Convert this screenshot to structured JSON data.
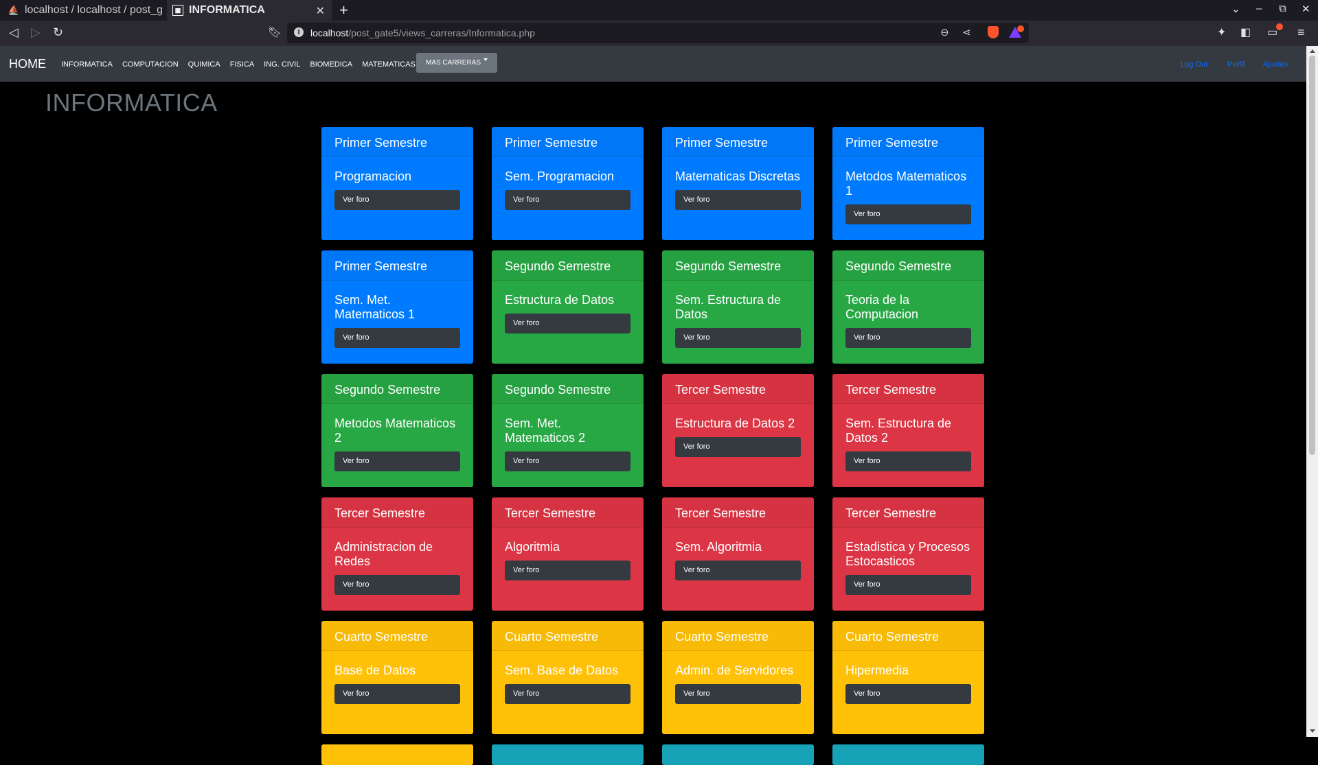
{
  "browser": {
    "tabs": [
      {
        "title": "localhost / localhost / post_g",
        "active": false
      },
      {
        "title": "INFORMATICA",
        "active": true
      }
    ],
    "url_host": "localhost",
    "url_path": "/post_gate5/views_carreras/Informatica.php"
  },
  "nav": {
    "brand": "HOME",
    "links": [
      "INFORMATICA",
      "COMPUTACION",
      "QUIMICA",
      "FISICA",
      "ING. CIVIL",
      "BIOMEDICA",
      "MATEMATICAS"
    ],
    "dropdown": "MAS CARRERAS",
    "logout": "Log Out",
    "perfil": "Perfil",
    "ajustes": "Ajustes"
  },
  "page": {
    "title": "INFORMATICA",
    "button_label": "Ver foro",
    "courses": [
      {
        "semester": "Primer Semestre",
        "name": "Programacion",
        "color": "blue"
      },
      {
        "semester": "Primer Semestre",
        "name": "Sem. Programacion",
        "color": "blue"
      },
      {
        "semester": "Primer Semestre",
        "name": "Matematicas Discretas",
        "color": "blue"
      },
      {
        "semester": "Primer Semestre",
        "name": "Metodos Matematicos 1",
        "color": "blue"
      },
      {
        "semester": "Primer Semestre",
        "name": "Sem. Met. Matematicos 1",
        "color": "blue"
      },
      {
        "semester": "Segundo Semestre",
        "name": "Estructura de Datos",
        "color": "green"
      },
      {
        "semester": "Segundo Semestre",
        "name": "Sem. Estructura de Datos",
        "color": "green"
      },
      {
        "semester": "Segundo Semestre",
        "name": "Teoria de la Computacion",
        "color": "green"
      },
      {
        "semester": "Segundo Semestre",
        "name": "Metodos Matematicos 2",
        "color": "green"
      },
      {
        "semester": "Segundo Semestre",
        "name": "Sem. Met. Matematicos 2",
        "color": "green"
      },
      {
        "semester": "Tercer Semestre",
        "name": "Estructura de Datos 2",
        "color": "red"
      },
      {
        "semester": "Tercer Semestre",
        "name": "Sem. Estructura de Datos 2",
        "color": "red"
      },
      {
        "semester": "Tercer Semestre",
        "name": "Administracion de Redes",
        "color": "red"
      },
      {
        "semester": "Tercer Semestre",
        "name": "Algoritmia",
        "color": "red"
      },
      {
        "semester": "Tercer Semestre",
        "name": "Sem. Algoritmia",
        "color": "red"
      },
      {
        "semester": "Tercer Semestre",
        "name": "Estadistica y Procesos Estocasticos",
        "color": "red"
      },
      {
        "semester": "Cuarto Semestre",
        "name": "Base de Datos",
        "color": "yellow"
      },
      {
        "semester": "Cuarto Semestre",
        "name": "Sem. Base de Datos",
        "color": "yellow"
      },
      {
        "semester": "Cuarto Semestre",
        "name": "Admin. de Servidores",
        "color": "yellow"
      },
      {
        "semester": "Cuarto Semestre",
        "name": "Hipermedia",
        "color": "yellow"
      }
    ],
    "partial_row_colors": [
      "yellow",
      "teal",
      "teal",
      "teal"
    ]
  },
  "colors": {
    "blue": "#007bff",
    "green": "#28a745",
    "red": "#dc3545",
    "yellow": "#ffc107",
    "teal": "#17a2b8",
    "navbar": "#343a40",
    "button": "#343a40"
  }
}
